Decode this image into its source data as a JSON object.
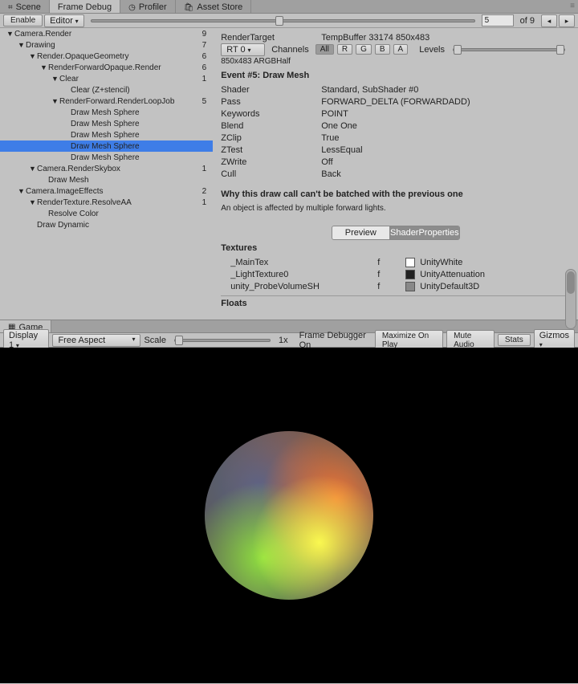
{
  "tabs_top": [
    "Scene",
    "Frame Debug",
    "Profiler",
    "Asset Store"
  ],
  "tabs_top_active": 1,
  "toolbar": {
    "enable": "Enable",
    "editor": "Editor",
    "frame": "5",
    "of": "of 9"
  },
  "tree": [
    {
      "d": 0,
      "f": "▼",
      "l": "Camera.Render",
      "n": "9"
    },
    {
      "d": 1,
      "f": "▼",
      "l": "Drawing",
      "n": "7"
    },
    {
      "d": 2,
      "f": "▼",
      "l": "Render.OpaqueGeometry",
      "n": "6"
    },
    {
      "d": 3,
      "f": "▼",
      "l": "RenderForwardOpaque.Render",
      "n": "6"
    },
    {
      "d": 4,
      "f": "▼",
      "l": "Clear",
      "n": "1"
    },
    {
      "d": 5,
      "f": "",
      "l": "Clear (Z+stencil)",
      "n": ""
    },
    {
      "d": 4,
      "f": "▼",
      "l": "RenderForward.RenderLoopJob",
      "n": "5"
    },
    {
      "d": 5,
      "f": "",
      "l": "Draw Mesh Sphere",
      "n": ""
    },
    {
      "d": 5,
      "f": "",
      "l": "Draw Mesh Sphere",
      "n": ""
    },
    {
      "d": 5,
      "f": "",
      "l": "Draw Mesh Sphere",
      "n": ""
    },
    {
      "d": 5,
      "f": "",
      "l": "Draw Mesh Sphere",
      "n": "",
      "sel": true
    },
    {
      "d": 5,
      "f": "",
      "l": "Draw Mesh Sphere",
      "n": ""
    },
    {
      "d": 2,
      "f": "▼",
      "l": "Camera.RenderSkybox",
      "n": "1"
    },
    {
      "d": 3,
      "f": "",
      "l": "Draw Mesh",
      "n": ""
    },
    {
      "d": 1,
      "f": "▼",
      "l": "Camera.ImageEffects",
      "n": "2"
    },
    {
      "d": 2,
      "f": "▼",
      "l": "RenderTexture.ResolveAA",
      "n": "1"
    },
    {
      "d": 3,
      "f": "",
      "l": "Resolve Color",
      "n": ""
    },
    {
      "d": 2,
      "f": "",
      "l": "Draw Dynamic",
      "n": ""
    }
  ],
  "detail": {
    "rt_label": "RenderTarget",
    "rt_value": "TempBuffer 33174 850x483",
    "rt_drop": "RT 0",
    "channels": "Channels",
    "ch": [
      "All",
      "R",
      "G",
      "B",
      "A"
    ],
    "levels": "Levels",
    "dims": "850x483 ARGBHalf",
    "event": "Event #5: Draw Mesh",
    "rows": [
      [
        "Shader",
        "Standard, SubShader #0"
      ],
      [
        "Pass",
        "FORWARD_DELTA (FORWARDADD)"
      ],
      [
        "Keywords",
        "POINT"
      ],
      [
        "Blend",
        "One One"
      ],
      [
        "ZClip",
        "True"
      ],
      [
        "ZTest",
        "LessEqual"
      ],
      [
        "ZWrite",
        "Off"
      ],
      [
        "Cull",
        "Back"
      ]
    ],
    "batch_title": "Why this draw call can't be batched with the previous one",
    "batch_reason": "An object is affected by multiple forward lights.",
    "preview": "Preview",
    "shaderprops": "ShaderProperties",
    "textures_h": "Textures",
    "textures": [
      {
        "name": "_MainTex",
        "f": "f",
        "c": "#ffffff",
        "val": "UnityWhite"
      },
      {
        "name": "_LightTexture0",
        "f": "f",
        "c": "#222222",
        "val": "UnityAttenuation"
      },
      {
        "name": "unity_ProbeVolumeSH",
        "f": "f",
        "c": "#888888",
        "val": "UnityDefault3D"
      }
    ],
    "floats_h": "Floats"
  },
  "game": {
    "tab": "Game",
    "display": "Display 1",
    "aspect": "Free Aspect",
    "scale": "Scale",
    "scale_val": "1x",
    "fd": "Frame Debugger On",
    "max": "Maximize On Play",
    "mute": "Mute Audio",
    "stats": "Stats",
    "gizmos": "Gizmos"
  }
}
